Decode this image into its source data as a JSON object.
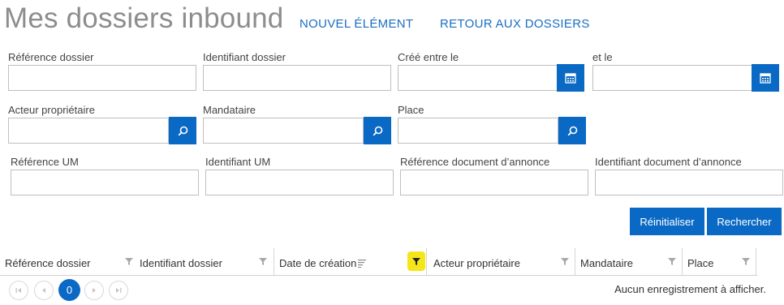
{
  "header": {
    "title": "Mes dossiers inbound",
    "new_item": "NOUVEL ÉLÉMENT",
    "back": "RETOUR AUX DOSSIERS"
  },
  "filters": {
    "ref_dossier": "Référence dossier",
    "id_dossier": "Identifiant dossier",
    "created_between": "Créé entre le",
    "and": "et le",
    "owner": "Acteur propriétaire",
    "mandataire": "Mandataire",
    "place": "Place",
    "ref_um": "Référence UM",
    "id_um": "Identifiant UM",
    "ref_doc": "Référence document d’annonce",
    "id_doc": "Identifiant document d’annonce"
  },
  "actions": {
    "reset": "Réinitialiser",
    "search": "Rechercher"
  },
  "grid": {
    "columns": [
      "Référence dossier",
      "Identifiant dossier",
      "Date de création",
      "Acteur propriétaire",
      "Mandataire",
      "Place"
    ],
    "active_filter_color": "#f5e61a"
  },
  "pager": {
    "current_page": "0",
    "empty_text": "Aucun enregistrement à afficher."
  }
}
